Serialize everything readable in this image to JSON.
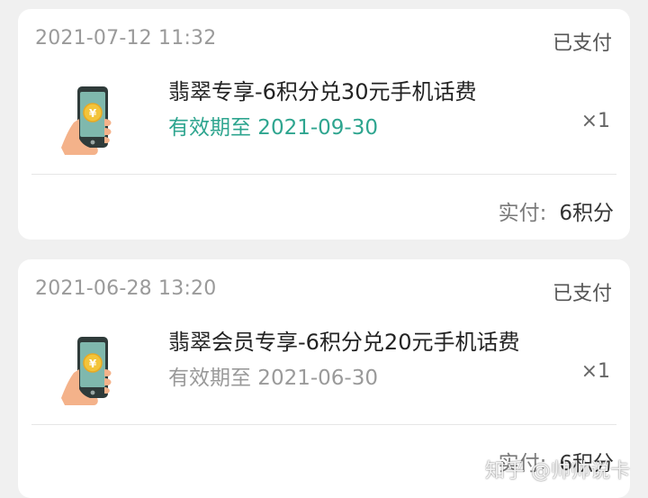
{
  "orders": [
    {
      "timestamp": "2021-07-12 11:32",
      "status": "已支付",
      "title": "翡翠专享-6积分兑30元手机话费",
      "validity": "有效期至 2021-09-30",
      "quantity": "×1",
      "paid_label": "实付:",
      "paid_value": "6积分",
      "icon": "phone-coin-icon",
      "validity_color": "#2ea58f"
    },
    {
      "timestamp": "2021-06-28 13:20",
      "status": "已支付",
      "title": "翡翠会员专享-6积分兑20元手机话费",
      "validity": "有效期至 2021-06-30",
      "quantity": "×1",
      "paid_label": "实付:",
      "paid_value": "6积分",
      "icon": "phone-coin-icon",
      "validity_color": "#9a9a9a"
    }
  ],
  "watermark": "知乎 @帅帅说卡"
}
